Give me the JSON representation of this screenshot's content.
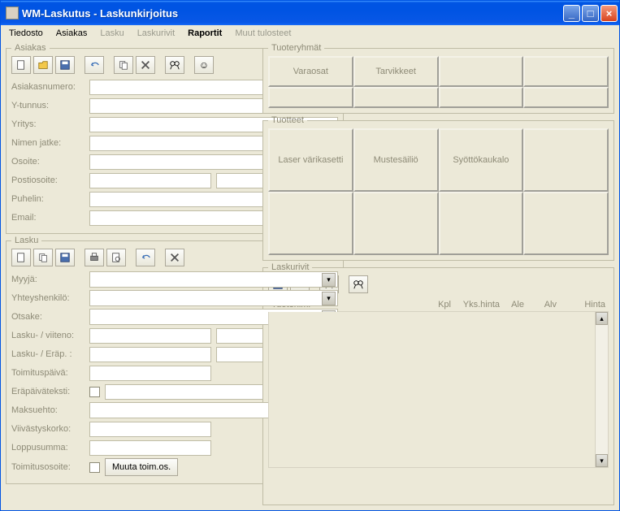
{
  "window": {
    "title": "WM-Laskutus - Laskunkirjoitus"
  },
  "menu": {
    "tiedosto": "Tiedosto",
    "asiakas": "Asiakas",
    "lasku": "Lasku",
    "laskurivit": "Laskurivit",
    "raportit": "Raportit",
    "muut": "Muut tulosteet"
  },
  "asiakas": {
    "legend": "Asiakas",
    "fields": {
      "asiakasnumero": "Asiakasnumero:",
      "ytunnus": "Y-tunnus:",
      "yritys": "Yritys:",
      "nimenjatke": "Nimen jatke:",
      "osoite": "Osoite:",
      "postiosoite": "Postiosoite:",
      "puhelin": "Puhelin:",
      "email": "Email:"
    },
    "icons": {
      "new": "new-icon",
      "open": "open-icon",
      "save": "save-icon",
      "undo": "undo-icon",
      "copy": "copy-icon",
      "delete": "delete-icon",
      "find": "find-icon",
      "help": "help-icon"
    }
  },
  "lasku": {
    "legend": "Lasku",
    "fields": {
      "myyja": "Myyjä:",
      "yhteyshenkilo": "Yhteyshenkilö:",
      "otsake": "Otsake:",
      "laskuviiteno": "Lasku- / viiteno:",
      "laskuerap": "Lasku- / Eräp. :",
      "toimituspaiva": "Toimituspäivä:",
      "erapaivateksti": "Eräpäiväteksti:",
      "maksuehto": "Maksuehto:",
      "viivastyskorko": "Viivästyskorko:",
      "loppusumma": "Loppusumma:",
      "toimitusosoite": "Toimitusosoite:"
    },
    "buttons": {
      "muuta": "Muuta toim.os."
    }
  },
  "tuoteryhmat": {
    "legend": "Tuoteryhmät",
    "items": [
      "Varaosat",
      "Tarvikkeet",
      "",
      ""
    ]
  },
  "tuotteet": {
    "legend": "Tuotteet",
    "items": [
      "Laser värikasetti",
      "Mustesäiliö",
      "Syöttökaukalo",
      "",
      "",
      "",
      "",
      ""
    ]
  },
  "laskurivit": {
    "legend": "Laskurivit",
    "headers": {
      "tuotenimi": "Tuotenimi",
      "kpl": "Kpl",
      "ykshinta": "Yks.hinta",
      "ale": "Ale",
      "alv": "Alv",
      "hinta": "Hinta"
    }
  }
}
